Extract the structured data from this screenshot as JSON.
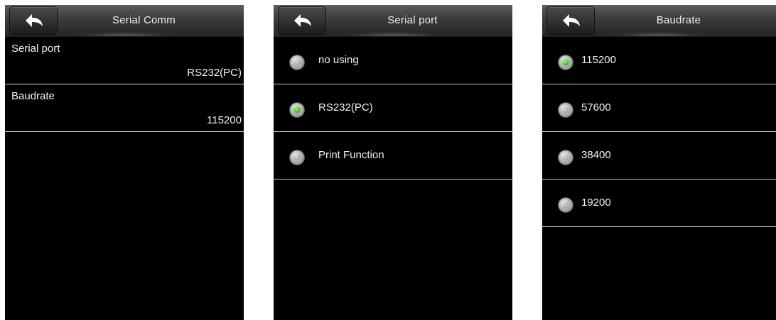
{
  "screens": [
    {
      "title": "Serial Comm",
      "settings": [
        {
          "label": "Serial port",
          "value": "RS232(PC)"
        },
        {
          "label": "Baudrate",
          "value": "115200"
        }
      ]
    },
    {
      "title": "Serial port",
      "options": [
        {
          "label": "no using",
          "selected": false
        },
        {
          "label": "RS232(PC)",
          "selected": true
        },
        {
          "label": "Print Function",
          "selected": false
        }
      ]
    },
    {
      "title": "Baudrate",
      "options": [
        {
          "label": "115200",
          "selected": true
        },
        {
          "label": "57600",
          "selected": false
        },
        {
          "label": "38400",
          "selected": false
        },
        {
          "label": "19200",
          "selected": false
        }
      ]
    }
  ],
  "icons": {
    "back": "back-arrow-icon",
    "radio": "radio-icon"
  },
  "colors": {
    "screen_bg": "#000000",
    "text": "#f2f2f2",
    "selected_radio": "#2fb315",
    "divider": "#c8c8c8"
  }
}
